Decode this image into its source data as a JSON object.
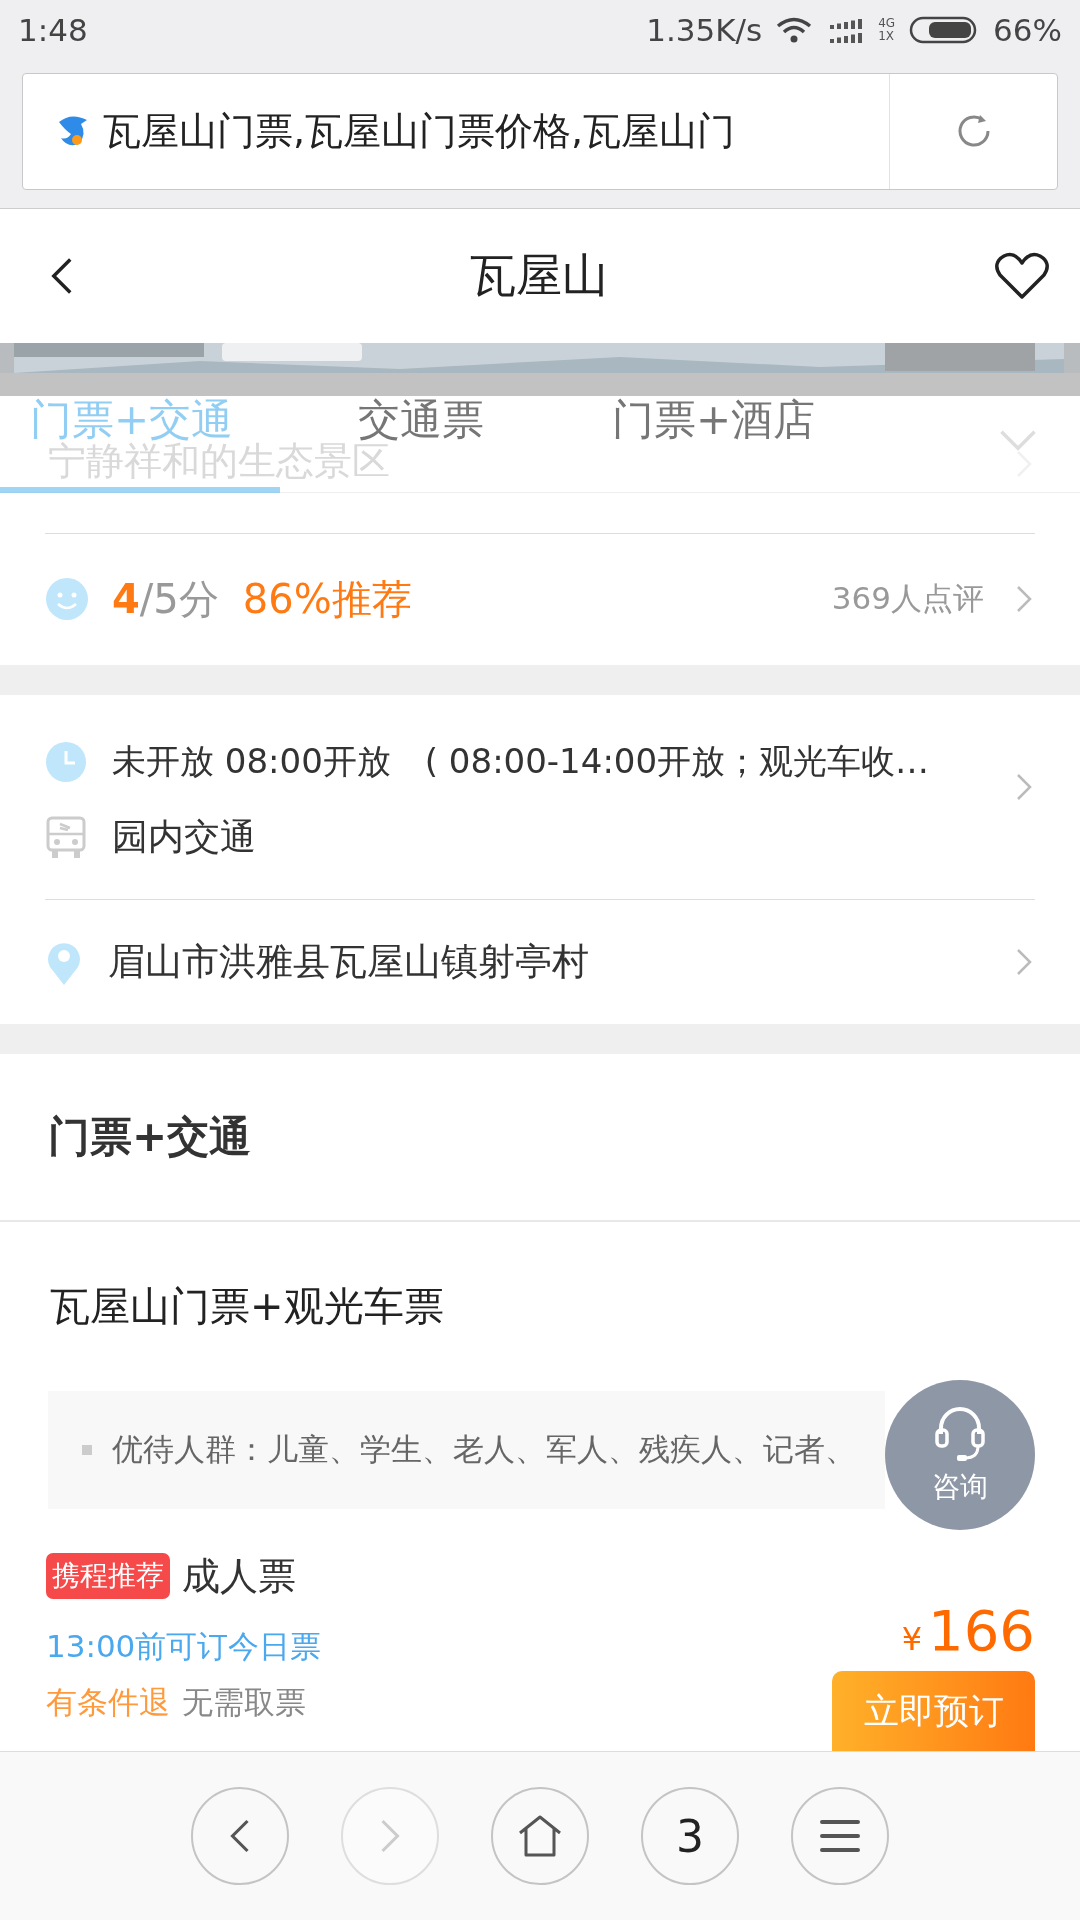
{
  "status_bar": {
    "time": "1:48",
    "speed": "1.35K/s",
    "network_top": "4G",
    "network_bottom": "1X",
    "battery": "66%"
  },
  "address_bar": {
    "title": "瓦屋山门票,瓦屋山门票价格,瓦屋山门"
  },
  "header": {
    "title": "瓦屋山",
    "favorited": false
  },
  "tabs": [
    {
      "label": "门票+交通",
      "selected": true
    },
    {
      "label": "交通票",
      "selected": false
    },
    {
      "label": "门票+酒店",
      "selected": false
    }
  ],
  "subtitle": "宁静祥和的生态景区",
  "rating": {
    "score": "4",
    "scale": "/5分",
    "recommend": "86%推荐",
    "reviews": "369人点评"
  },
  "info": {
    "hours": "未开放 08:00开放　( 08:00-14:00开放；观光车收…",
    "transport": "园内交通",
    "address": "眉山市洪雅县瓦屋山镇射亭村"
  },
  "section_title": "门票+交通",
  "product": {
    "title": "瓦屋山门票+观光车票",
    "benefits": "优待人群：儿童、学生、老人、军人、残疾人、记者、",
    "ticket": {
      "tag": "携程推荐",
      "name": "成人票",
      "booking_note": "13:00前可订今日票",
      "refund": "有条件退",
      "pickup": "无需取票",
      "currency": "¥",
      "price": "166",
      "book_button": "立即预订"
    }
  },
  "consult": {
    "label": "咨询"
  },
  "bottom_nav": [
    {
      "kind": "back",
      "disabled": false
    },
    {
      "kind": "forward",
      "disabled": true
    },
    {
      "kind": "home",
      "disabled": false
    },
    {
      "kind": "tabs",
      "label": "3",
      "disabled": false
    },
    {
      "kind": "menu",
      "disabled": false
    }
  ]
}
